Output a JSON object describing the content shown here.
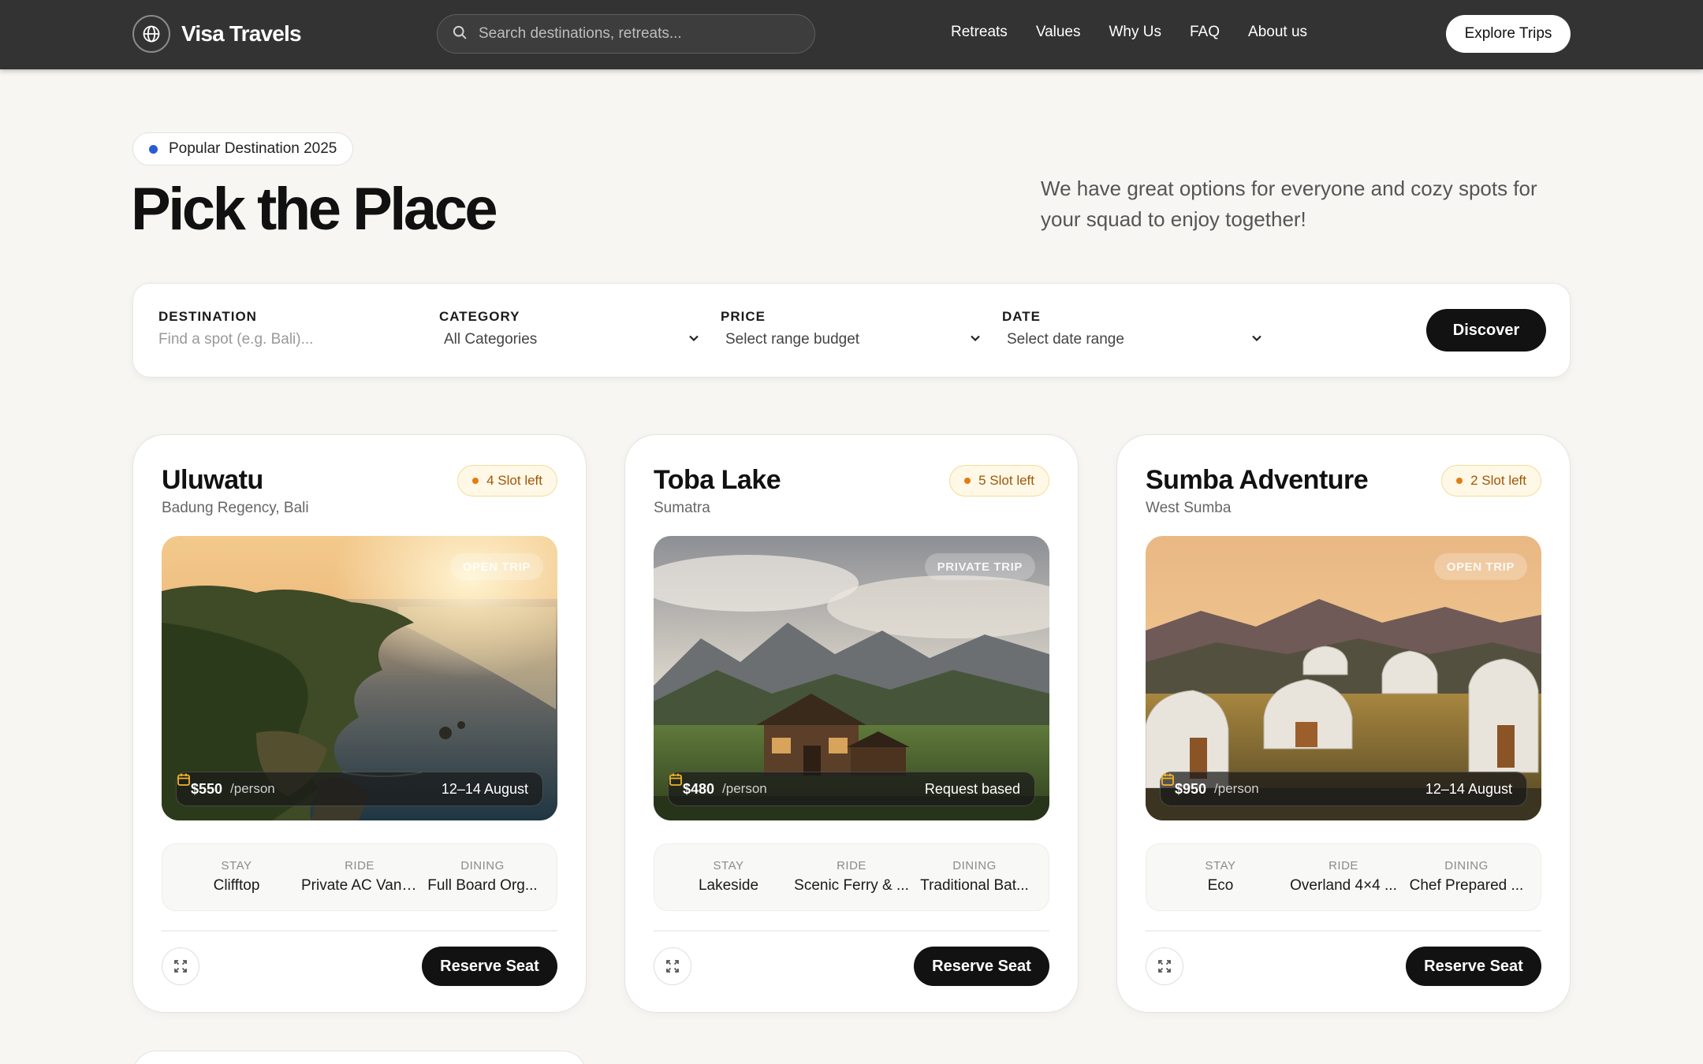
{
  "header": {
    "brand": "Visa Travels",
    "search_placeholder": "Search destinations, retreats...",
    "nav": [
      "Retreats",
      "Values",
      "Why Us",
      "FAQ",
      "About us"
    ],
    "cta": "Explore Trips"
  },
  "hero": {
    "badge": "Popular Destination 2025",
    "title": "Pick the Place",
    "subtitle": "We have great options for everyone and cozy spots for your squad to enjoy together!"
  },
  "filters": {
    "destination": {
      "label": "DESTINATION",
      "placeholder": "Find a spot (e.g. Bali)..."
    },
    "category": {
      "label": "CATEGORY",
      "value": "All Categories"
    },
    "price": {
      "label": "PRICE",
      "value": "Select range budget"
    },
    "date": {
      "label": "DATE",
      "value": "Select date range"
    },
    "submit": "Discover"
  },
  "cards": [
    {
      "title": "Uluwatu",
      "location": "Badung Regency, Bali",
      "slots": "4 Slot left",
      "trip_type": "OPEN TRIP",
      "price": "$550",
      "per": "/person",
      "date": "12–14 August",
      "amenities": [
        {
          "key": "STAY",
          "value": "Clifftop"
        },
        {
          "key": "RIDE",
          "value": "Private AC Van ..."
        },
        {
          "key": "DINING",
          "value": "Full Board Org..."
        }
      ],
      "action": "Reserve Seat"
    },
    {
      "title": "Toba Lake",
      "location": "Sumatra",
      "slots": "5 Slot left",
      "trip_type": "PRIVATE TRIP",
      "price": "$480",
      "per": "/person",
      "date": "Request based",
      "amenities": [
        {
          "key": "STAY",
          "value": "Lakeside"
        },
        {
          "key": "RIDE",
          "value": "Scenic Ferry & ..."
        },
        {
          "key": "DINING",
          "value": "Traditional Bat..."
        }
      ],
      "action": "Reserve Seat"
    },
    {
      "title": "Sumba Adventure",
      "location": "West Sumba",
      "slots": "2 Slot left",
      "trip_type": "OPEN TRIP",
      "price": "$950",
      "per": "/person",
      "date": "12–14 August",
      "amenities": [
        {
          "key": "STAY",
          "value": "Eco"
        },
        {
          "key": "RIDE",
          "value": "Overland 4×4 ..."
        },
        {
          "key": "DINING",
          "value": "Chef Prepared ..."
        }
      ],
      "action": "Reserve Seat"
    }
  ],
  "colors": {
    "header_bg": "#333333",
    "page_bg": "#f7f6f3",
    "accent_dark": "#121212",
    "badge_dot": "#2a5bd7",
    "slot_text": "#a0560a",
    "slot_dot": "#e07d14"
  }
}
